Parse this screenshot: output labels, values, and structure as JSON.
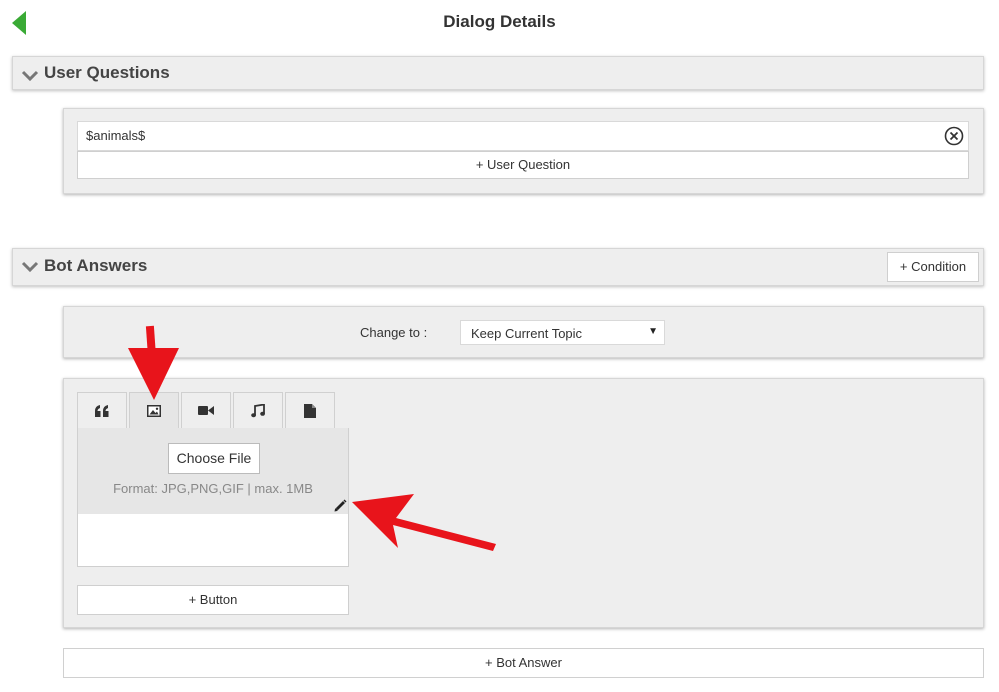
{
  "header": {
    "title": "Dialog Details"
  },
  "user_questions": {
    "title": "User Questions",
    "items": [
      {
        "value": "$animals$"
      }
    ],
    "add_label": "+ User Question"
  },
  "bot_answers": {
    "title": "Bot Answers",
    "condition_label": "+ Condition",
    "change_to_label": "Change to :",
    "change_to_value": "Keep Current Topic",
    "tabs": [
      {
        "icon": "quote-icon"
      },
      {
        "icon": "image-icon"
      },
      {
        "icon": "video-icon"
      },
      {
        "icon": "music-icon"
      },
      {
        "icon": "file-icon"
      }
    ],
    "choose_file_label": "Choose File",
    "format_text": "Format: JPG,PNG,GIF | max. 1MB",
    "add_button_label": "+ Button",
    "add_answer_label": "+ Bot Answer"
  },
  "colors": {
    "back_arrow": "#3aaa35",
    "annotation_arrow": "#e8141b"
  }
}
